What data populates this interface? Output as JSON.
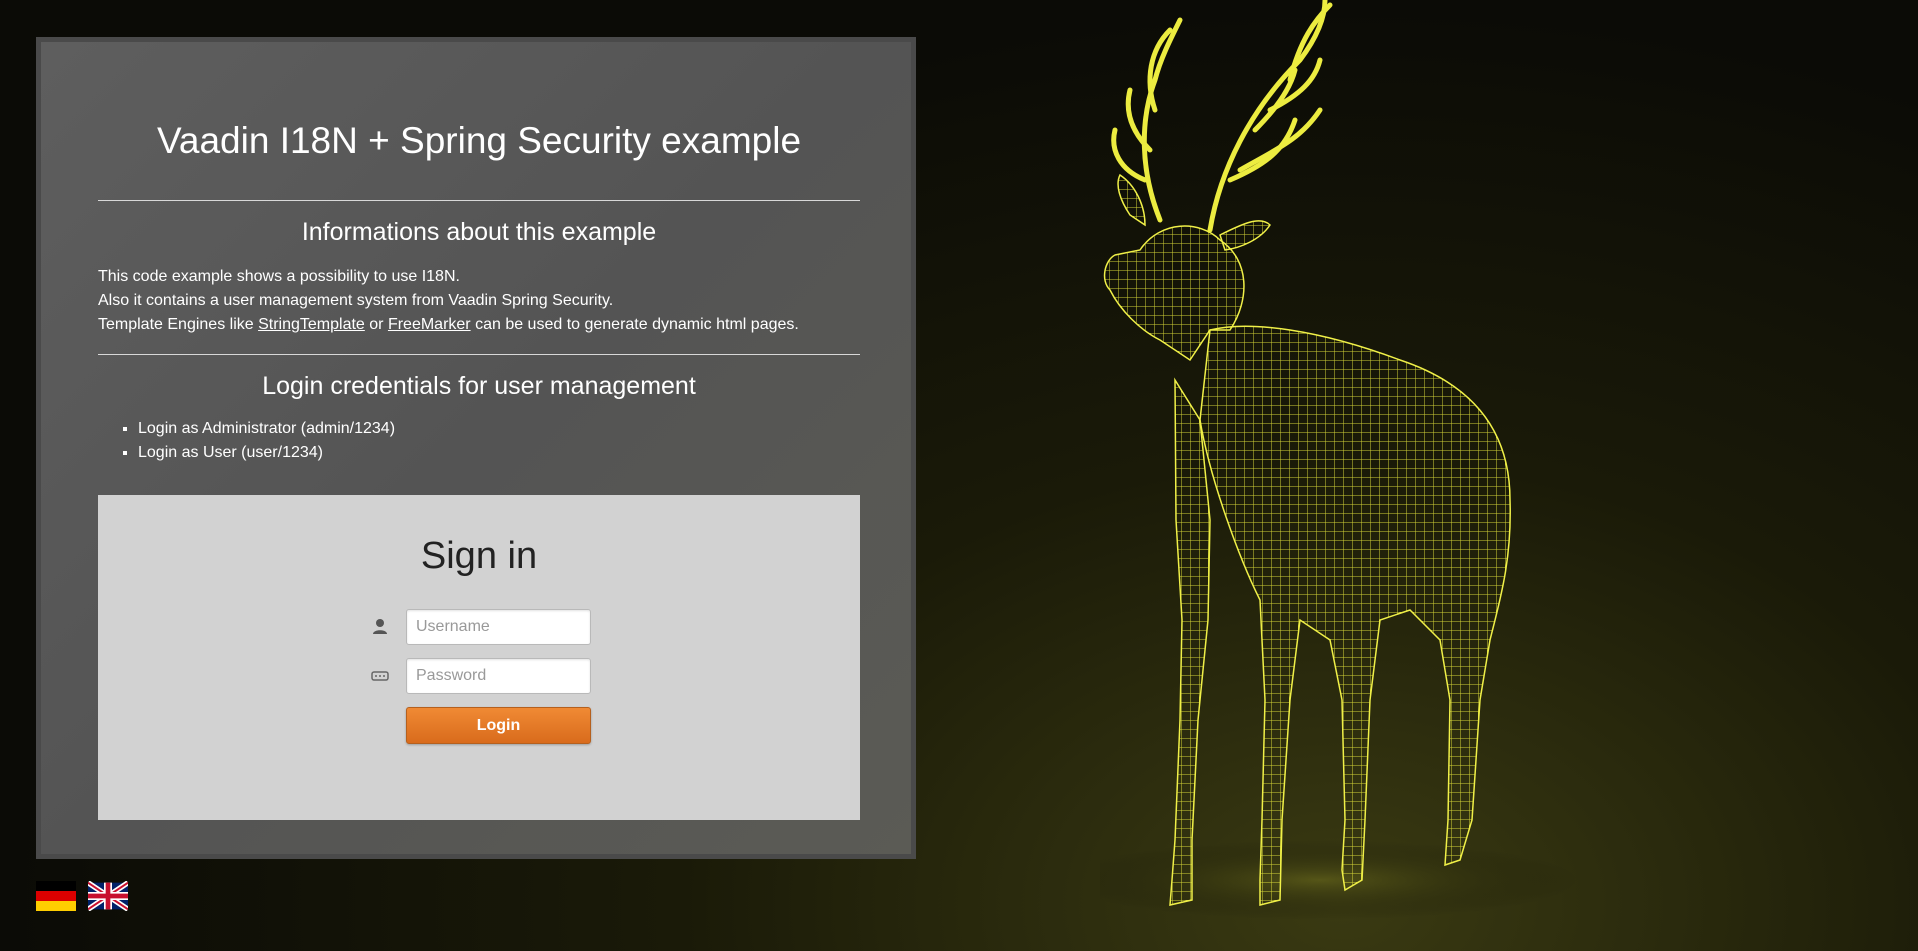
{
  "page": {
    "title": "Vaadin I18N + Spring Security example"
  },
  "info": {
    "heading": "Informations about this example",
    "line1": "This code example shows a possibility to use I18N.",
    "line2": "Also it contains a user management system from Vaadin Spring Security.",
    "line3_prefix": "Template Engines like ",
    "link1": "StringTemplate",
    "line3_mid": " or ",
    "link2": "FreeMarker",
    "line3_suffix": " can be used to generate dynamic html pages."
  },
  "credentials": {
    "heading": "Login credentials for user management",
    "items": [
      "Login as Administrator (admin/1234)",
      "Login as User (user/1234)"
    ]
  },
  "signin": {
    "title": "Sign in",
    "username_placeholder": "Username",
    "password_placeholder": "Password",
    "username_value": "",
    "password_value": "",
    "login_label": "Login"
  },
  "languages": [
    {
      "code": "de",
      "icon": "german-flag-icon"
    },
    {
      "code": "en",
      "icon": "uk-flag-icon"
    }
  ],
  "colors": {
    "accent": "#e07a28",
    "panel": "#585858",
    "signin_bg": "#d2d2d2",
    "deer_wireframe": "#e8e83a"
  }
}
